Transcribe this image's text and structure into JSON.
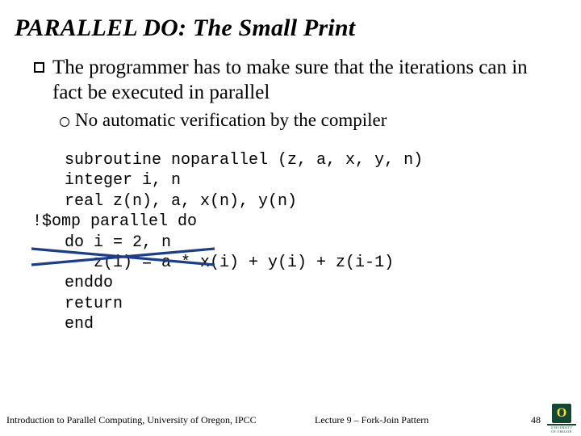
{
  "title": "PARALLEL DO: The Small Print",
  "bullet1": "The programmer has to make sure that the iterations can in fact be executed in parallel",
  "bullet2": "No automatic verification by the compiler",
  "code": {
    "l1": "subroutine noparallel (z, a, x, y, n)",
    "l2": "integer i, n",
    "l3": "real z(n), a, x(n), y(n)",
    "l4": "!$omp parallel do",
    "l5": "do i = 2, n",
    "l6": "   z(i) = a * x(i) + y(i) + z(i-1)",
    "l7": "enddo",
    "l8": "return",
    "l9": "end"
  },
  "footer": {
    "left": "Introduction to Parallel Computing, University of Oregon, IPCC",
    "center": "Lecture 9 – Fork-Join Pattern",
    "page": "48"
  },
  "logo": {
    "letter": "O",
    "word1": "UNIVERSITY",
    "word2": "OF OREGON"
  }
}
